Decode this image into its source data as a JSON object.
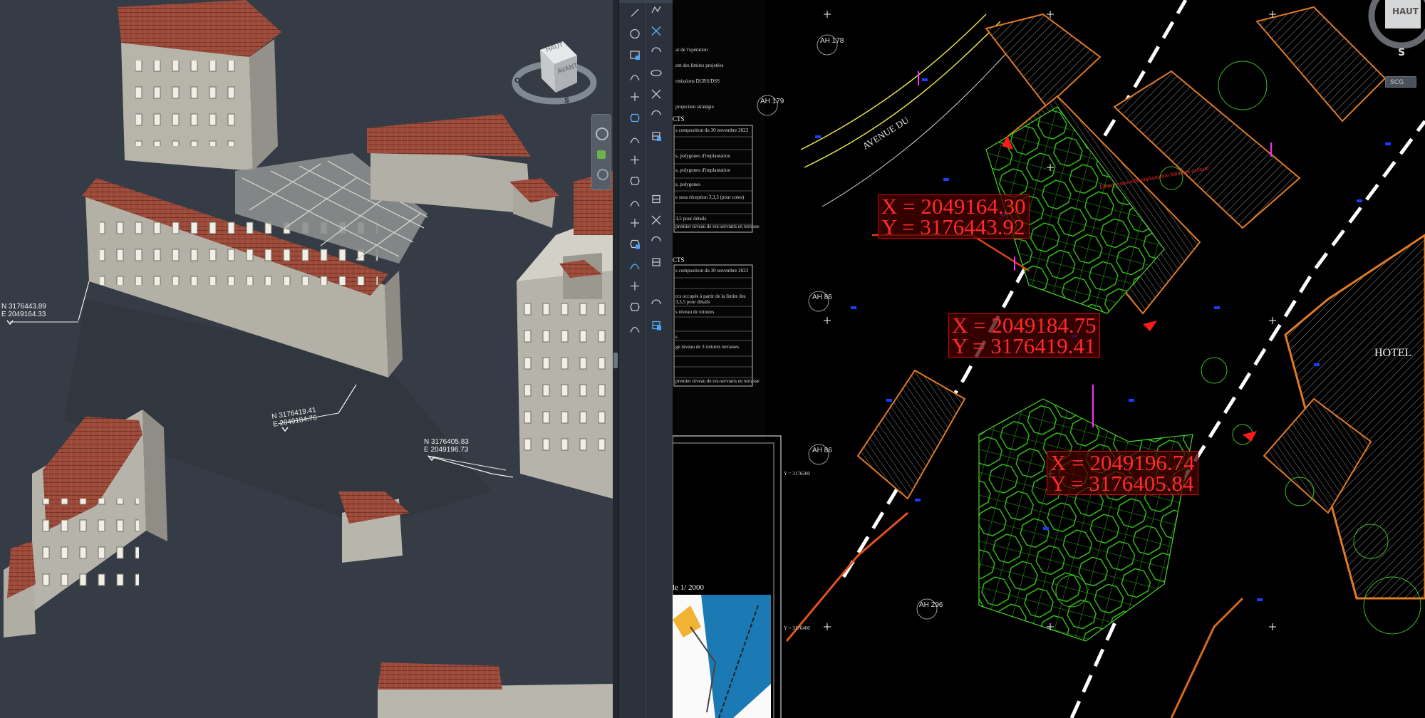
{
  "viewport3d": {
    "viewcube": {
      "top": "HAUT",
      "front": "AVANT",
      "compass_s": "S",
      "compass_o": "O"
    },
    "markers": [
      {
        "n": "N 3176443.89",
        "e": "E 2049164.33"
      },
      {
        "n": "N 3176419.41",
        "e": "E 2049184.76"
      },
      {
        "n": "N 3176405.83",
        "e": "E 2049196.73"
      }
    ]
  },
  "toolbar": {
    "icons": [
      "line-icon",
      "polyline-icon",
      "circle-icon",
      "arc-icon",
      "rectangle-icon",
      "polygon-icon",
      "spline-icon",
      "ellipse-icon",
      "hatch-icon",
      "gradient-icon",
      "block-icon",
      "point-icon",
      "region-icon",
      "table-icon",
      "text-icon",
      "mtext-icon",
      "dimension-icon",
      "move-icon",
      "copy-icon",
      "rotate-icon",
      "scale-icon",
      "stretch-icon",
      "trim-icon",
      "extend-icon",
      "fillet-icon",
      "chamfer-icon",
      "array-icon",
      "mirror-icon",
      "offset-icon",
      "explode-icon",
      "layer-icon",
      "properties-icon"
    ]
  },
  "plan": {
    "viewcube": {
      "top": "HAUT",
      "compass_s": "S",
      "ucs": "SCG"
    },
    "coords": [
      {
        "x": "X = 2049164.30",
        "y": "Y = 3176443.92"
      },
      {
        "x": "X = 2049184.75",
        "y": "Y = 3176419.41"
      },
      {
        "x": "X = 2049196.74",
        "y": "Y = 3176405.84"
      }
    ],
    "parcels": [
      "AH 178",
      "AH 179",
      "AH 86",
      "AH 86",
      "AH 296"
    ],
    "street": "AVENUE DU",
    "hotel": "HOTEL",
    "scale_label": "le 1/ 2000",
    "grid_labels": [
      "Y = 3176500",
      "Y = 3176400"
    ],
    "legend_header_1": "CTS",
    "legend_header_2": "CTS",
    "legend_top": [
      "ar de l'opération",
      "ent des limites projetées",
      "rmissions DGRS/DSS",
      "projection stratégie"
    ],
    "legend_rows_1": [
      "s composition du 30 novembre 2023",
      "",
      "s, polygones d'implantation",
      "",
      "s, polygones d'implantation",
      "s, polygones",
      "e sous réception 3,3,5 (pour cotes)",
      "",
      "3,5 pour détails",
      "premier niveau de rez-servants en terrasse"
    ],
    "legend_rows_2": [
      "s composition du 30 novembre 2023",
      "",
      "rcs occupés à partir de la limite des 3,3,5 pour détails",
      "s niveau de toitures",
      "",
      "s",
      "ge niveau de 3 toitures terrasses",
      "",
      "",
      "premier niveau de rez-servants en terrasse"
    ],
    "red_note": "Emprise nouvelle implantation bâtiment existant"
  }
}
